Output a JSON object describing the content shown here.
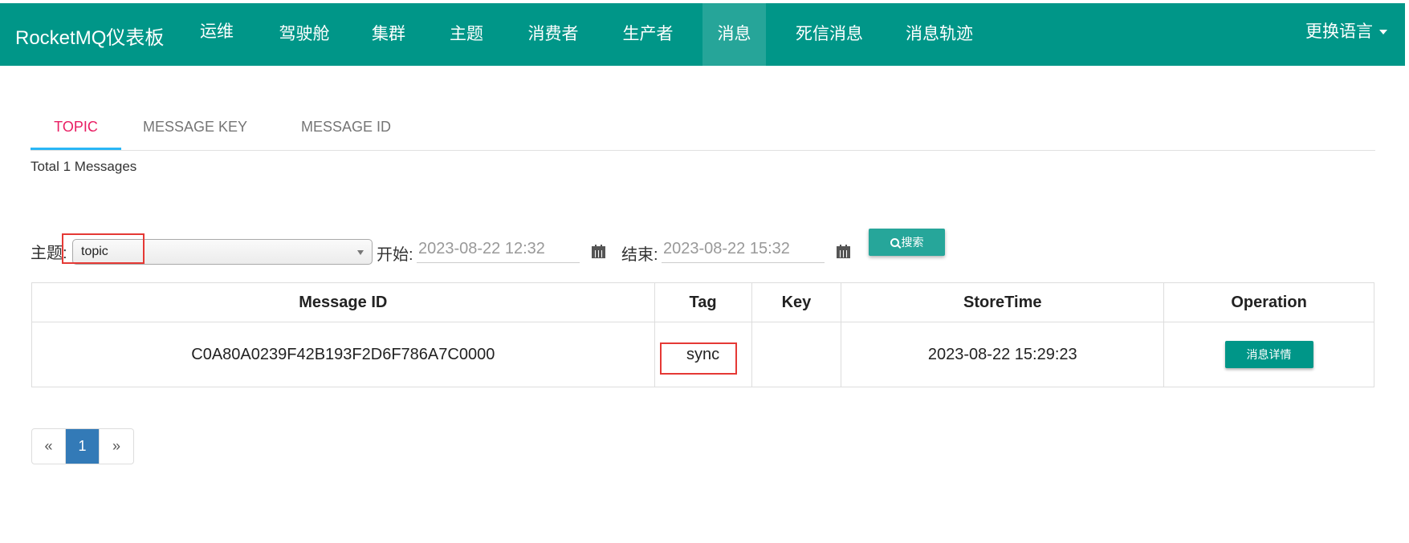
{
  "navbar": {
    "brand": "RocketMQ仪表板",
    "items": [
      "运维",
      "驾驶舱",
      "集群",
      "主题",
      "消费者",
      "生产者",
      "消息",
      "死信消息",
      "消息轨迹"
    ],
    "active": "消息",
    "language_label": "更换语言"
  },
  "tabs": [
    {
      "label": "TOPIC",
      "active": true
    },
    {
      "label": "MESSAGE KEY",
      "active": false
    },
    {
      "label": "MESSAGE ID",
      "active": false
    }
  ],
  "total_text": "Total 1 Messages",
  "filters": {
    "topic_label": "主题:",
    "topic_value": "topic",
    "start_label": "开始:",
    "start_value": "2023-08-22 12:32",
    "end_label": "结束:",
    "end_value": "2023-08-22 15:32",
    "search_label": "搜索"
  },
  "table": {
    "headers": [
      "Message ID",
      "Tag",
      "Key",
      "StoreTime",
      "Operation"
    ],
    "rows": [
      {
        "message_id": "C0A80A0239F42B193F2D6F786A7C0000",
        "tag": "sync",
        "key": "",
        "store_time": "2023-08-22 15:29:23",
        "operation": "消息详情"
      }
    ]
  },
  "pagination": {
    "prev": "«",
    "current": "1",
    "next": "»"
  },
  "colors": {
    "navbar": "#009688",
    "active_tab": "#e91e63",
    "tab_underline": "#29b6f6",
    "button": "#26a69a",
    "highlight": "#e53935"
  }
}
